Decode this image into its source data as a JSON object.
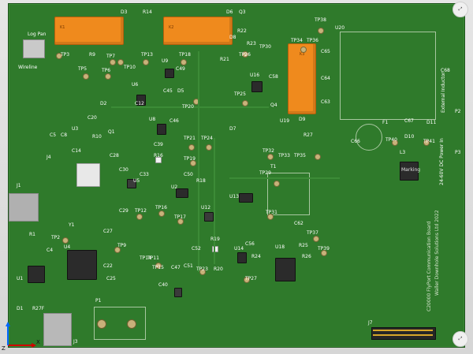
{
  "labels": {
    "D3": "D3",
    "R14": "R14",
    "D6": "D6",
    "Q3": "Q3",
    "TP38": "TP38",
    "U20": "U20",
    "LogPan": "Log Pan",
    "TP3": "TP3",
    "R9": "R9",
    "TP13": "TP13",
    "TP18": "TP18",
    "Wireline": "Wireline",
    "R22": "R22",
    "D8": "D8",
    "R23": "R23",
    "TP30": "TP30",
    "TP34": "TP34",
    "TP36": "TP36",
    "C65": "C65",
    "C68": "C68",
    "TP5": "TP5",
    "TP6": "TP6",
    "TP7": "TP7",
    "TP10": "TP10",
    "U9": "U9",
    "C49": "C49",
    "R21": "R21",
    "TP26": "TP26",
    "U16": "U16",
    "C58": "C58",
    "C64": "C64",
    "U6": "U6",
    "C12": "C12",
    "C45": "C45",
    "D5": "D5",
    "TP25": "TP25",
    "D2": "D2",
    "C20": "C20",
    "TP20": "TP20",
    "U8": "U8",
    "C46": "C46",
    "C63": "C63",
    "Q4": "Q4",
    "U3": "U3",
    "C5": "C5",
    "C8": "C8",
    "R10": "R10",
    "Q1": "Q1",
    "C39": "C39",
    "TP21": "TP21",
    "TP24": "TP24",
    "D7": "D7",
    "U19": "U19",
    "D9": "D9",
    "R27": "R27",
    "F1": "F1",
    "C67": "C67",
    "D11": "D11",
    "C14": "C14",
    "C28": "C28",
    "R16": "R16",
    "TP32": "TP32",
    "TP33": "TP33",
    "TP35": "TP35",
    "TP40": "TP40",
    "D10": "D10",
    "TP41": "TP41",
    "J4": "J4",
    "TP19": "TP19",
    "C30": "C30",
    "C33": "C33",
    "C50": "C50",
    "TP29": "TP29",
    "T1": "T1",
    "L3": "L3",
    "Marking": "Marking",
    "J1": "J1",
    "U5": "U5",
    "R18": "R18",
    "U2": "U2",
    "C29": "C29",
    "TP12": "TP12",
    "TP16": "TP16",
    "TP17": "TP17",
    "U12": "U12",
    "U13": "U13",
    "TP31": "TP31",
    "C66": "C66",
    "R1": "R1",
    "TP2": "TP2",
    "Y1": "Y1",
    "C27": "C27",
    "TP9": "TP9",
    "U4": "U4",
    "C4": "C4",
    "R19": "R19",
    "C56": "C56",
    "U18": "U18",
    "C62": "C62",
    "TP37": "TP37",
    "TP39": "TP39",
    "R25": "R25",
    "R26": "R26",
    "U14": "U14",
    "R24": "R24",
    "C52": "C52",
    "C51": "C51",
    "TP23": "TP23",
    "R20": "R20",
    "TP15": "TP15",
    "TP14": "TP14",
    "TP11": "TP11",
    "U1": "U1",
    "C25": "C25",
    "C22": "C22",
    "C40": "C40",
    "C47": "C47",
    "TP27": "TP27",
    "R27F": "R27F",
    "P1": "P1",
    "J3": "J3",
    "J7": "J7",
    "P2": "P2",
    "P3": "P3",
    "D1": "D1"
  },
  "board_text": {
    "vertical_title": "C20000 FlyPort Communication Board",
    "vertical_sub": "Waller Downhole Solutions Ltd 2022",
    "power": "24-60V DC Power In",
    "ext_inductor": "External Inductor"
  },
  "axis": {
    "z": "Z",
    "x": "X"
  },
  "badge": "⤢"
}
